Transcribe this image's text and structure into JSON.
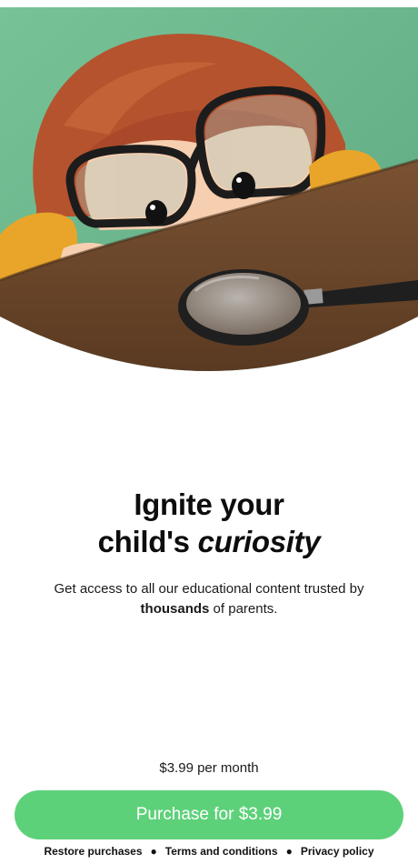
{
  "hero": {
    "illustration": "child-with-glasses-and-magnifying-glass"
  },
  "headline": {
    "line1": "Ignite your",
    "line2_prefix": "child's ",
    "line2_emphasis": "curiosity"
  },
  "subtitle": {
    "before": "Get access to all our educational content trusted by ",
    "bold": "thousands",
    "after": " of parents."
  },
  "price_text": "$3.99 per month",
  "purchase_button": {
    "label": "Purchase for $3.99"
  },
  "footer": {
    "restore": "Restore purchases",
    "terms": "Terms and conditions",
    "privacy": "Privacy policy",
    "separator": "●"
  },
  "colors": {
    "accent": "#5dd17a",
    "hero_background": "#6fb88e",
    "table": "#6e4a2d",
    "hair": "#b5532e",
    "sweater": "#e9a52a"
  }
}
